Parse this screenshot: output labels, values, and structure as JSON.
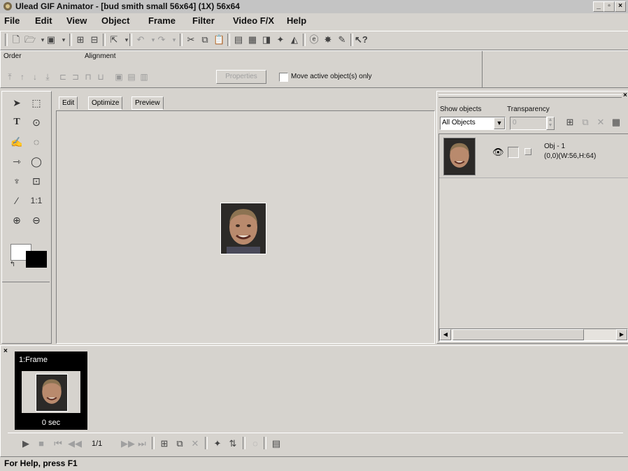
{
  "window": {
    "title": "Ulead GIF Animator - [bud smith small 56x64] (1X) 56x64",
    "minimize": "_",
    "restore": "▫",
    "close": "×"
  },
  "menu": [
    "File",
    "Edit",
    "View",
    "Object",
    "Frame",
    "Filter",
    "Video F/X",
    "Help"
  ],
  "order_bar": {
    "order_label": "Order",
    "alignment_label": "Alignment",
    "properties_button": "Properties",
    "move_active_label": "Move active object(s) only"
  },
  "tabs": [
    "Edit",
    "Optimize",
    "Preview"
  ],
  "objects_panel": {
    "show_objects_label": "Show objects",
    "transparency_label": "Transparency",
    "show_objects_value": "All Objects",
    "transparency_value": "0",
    "object": {
      "name": "Obj - 1",
      "info": "(0,0)(W:56,H:64)"
    }
  },
  "frames_panel": {
    "frame_label": "1:Frame",
    "frame_delay": "0 sec",
    "frame_counter": "1/1"
  },
  "status": {
    "text": "For Help, press F1"
  },
  "colors": {
    "face": "#d6d3ce",
    "canvas": "#d9d6d1",
    "selected_frame": "#000000"
  }
}
